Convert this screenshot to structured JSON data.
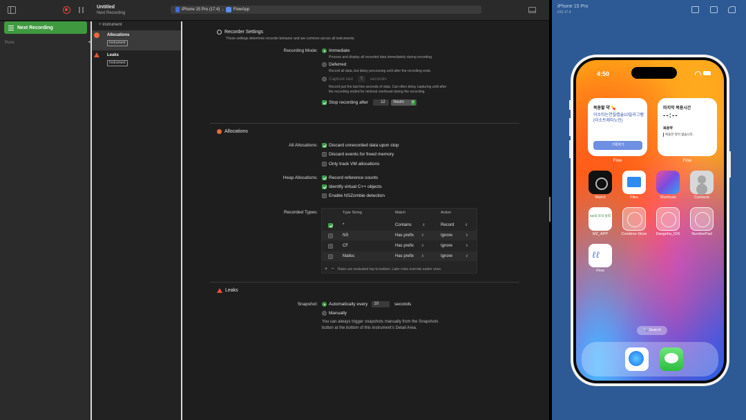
{
  "toolbar": {
    "doc_title": "Untitled",
    "doc_subtitle": "Next Recording",
    "device": "iPhone 15 Pro (17.4)",
    "app": "FlowApp"
  },
  "sidebar": {
    "next_recording": "Next Recording",
    "runs_label": "Runs"
  },
  "instruments": {
    "add_label": "+ Instrument",
    "items": [
      {
        "name": "Allocations",
        "tag": "Instrument"
      },
      {
        "name": "Leaks",
        "tag": "Instrument"
      }
    ]
  },
  "recorder": {
    "title": "Recorder Settings",
    "subtitle": "These settings determine recorder behavior and are common across all instruments.",
    "mode_label": "Recording Mode:",
    "immediate": "Immediate",
    "immediate_help": "Process and display all recorded data immediately during recording.",
    "deferred": "Deferred",
    "deferred_help": "Record all data, but delay processing until after the recording ends.",
    "capture_last": "Capture last",
    "capture_value": "5",
    "capture_unit": "seconds",
    "capture_help_1": "Record just the last few seconds of data. Can often delay capturing until after",
    "capture_help_2": "the recording ended for minimal overhead during the recording.",
    "stop_label": "Stop recording after",
    "stop_value": "12",
    "stop_unit": "hours"
  },
  "allocations": {
    "title": "Allocations",
    "all_label": "All Allocations:",
    "discard_unrecorded": "Discard unrecorded data upon stop",
    "discard_freed": "Discard events for freed memory",
    "only_vm": "Only track VM allocations",
    "heap_label": "Heap Allocations:",
    "record_refs": "Record reference counts",
    "identify_cpp": "Identify virtual C++ objects",
    "nszombie": "Enable NSZombie detection",
    "types_label": "Recorded Types:",
    "table": {
      "headers": [
        "Type String",
        "Match",
        "Action"
      ],
      "rows": [
        {
          "checked": true,
          "type": "*",
          "match": "Contains",
          "action": "Record"
        },
        {
          "checked": false,
          "type": "NS",
          "match": "Has prefix",
          "action": "Ignore"
        },
        {
          "checked": false,
          "type": "CF",
          "match": "Has prefix",
          "action": "Ignore"
        },
        {
          "checked": false,
          "type": "Malloc",
          "match": "Has prefix",
          "action": "Ignore"
        }
      ],
      "footer_add": "+",
      "footer_remove": "−",
      "footer_note": "Rules are evaluated top-to-bottom. Later rules override earlier ones."
    }
  },
  "leaks": {
    "title": "Leaks",
    "snapshot_label": "Snapshot:",
    "auto_label": "Automatically every",
    "auto_value": "10",
    "auto_unit": "seconds",
    "manual_label": "Manually",
    "help_1": "You can always trigger snapshots manually from the Snapshots",
    "help_2": "button at the bottom of this instrument's Detail Area."
  },
  "simulator": {
    "title": "iPhone 15 Pro",
    "os": "iOS 17.4",
    "time": "4:50",
    "widget_flow": {
      "title": "복용할 약 💊",
      "body": "이소티논연질캡슐10밀리그램(이소트레티노인)",
      "button": "기록하기",
      "caption": "Flow"
    },
    "widget_recent": {
      "title": "마지막 복용시간",
      "value": "--:--",
      "sub": "복용약",
      "note": "복용한 약이 없습니다.",
      "caption": "Flow"
    },
    "apps": [
      {
        "label": "Watch"
      },
      {
        "label": "Files"
      },
      {
        "label": "Shortcuts"
      },
      {
        "label": "Contacts"
      },
      {
        "label": "MZ_APP",
        "inner": "MZ의 토익 실력"
      },
      {
        "label": "Combine-Store"
      },
      {
        "label": "Daegeha_IOS"
      },
      {
        "label": "NumberPad"
      },
      {
        "label": "Flow"
      }
    ],
    "search": "🔍 Search"
  }
}
